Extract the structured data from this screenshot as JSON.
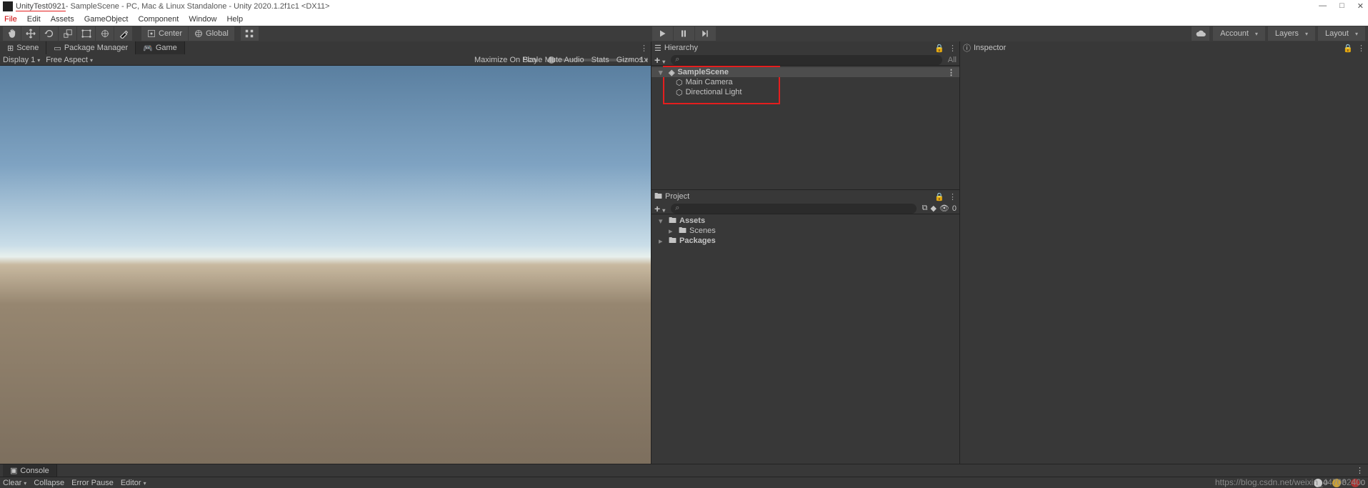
{
  "window": {
    "project_name": "UnityTest0921",
    "title_rest": " - SampleScene - PC, Mac & Linux Standalone - Unity 2020.1.2f1c1 <DX11>"
  },
  "menu": {
    "file": "File",
    "edit": "Edit",
    "assets": "Assets",
    "gameobject": "GameObject",
    "component": "Component",
    "window": "Window",
    "help": "Help"
  },
  "toolbar": {
    "center": "Center",
    "global": "Global",
    "account": "Account",
    "layers": "Layers",
    "layout": "Layout"
  },
  "tabs": {
    "scene": "Scene",
    "package_manager": "Package Manager",
    "game": "Game"
  },
  "scene_opts": {
    "display": "Display 1",
    "aspect": "Free Aspect",
    "scale_label": "Scale",
    "scale_value": "1x",
    "maximize": "Maximize On Play",
    "mute": "Mute Audio",
    "stats": "Stats",
    "gizmos": "Gizmos"
  },
  "hierarchy": {
    "title": "Hierarchy",
    "all": "All",
    "scene": "SampleScene",
    "items": [
      "Main Camera",
      "Directional Light"
    ]
  },
  "project": {
    "title": "Project",
    "hidden_count": "0",
    "assets": "Assets",
    "scenes": "Scenes",
    "packages": "Packages"
  },
  "inspector": {
    "title": "Inspector"
  },
  "console": {
    "title": "Console",
    "clear": "Clear",
    "collapse": "Collapse",
    "error_pause": "Error Pause",
    "editor": "Editor",
    "info_count": "0",
    "warn_count": "0",
    "err_count": "0"
  },
  "watermark": "https://blog.csdn.net/weixin_44708240"
}
